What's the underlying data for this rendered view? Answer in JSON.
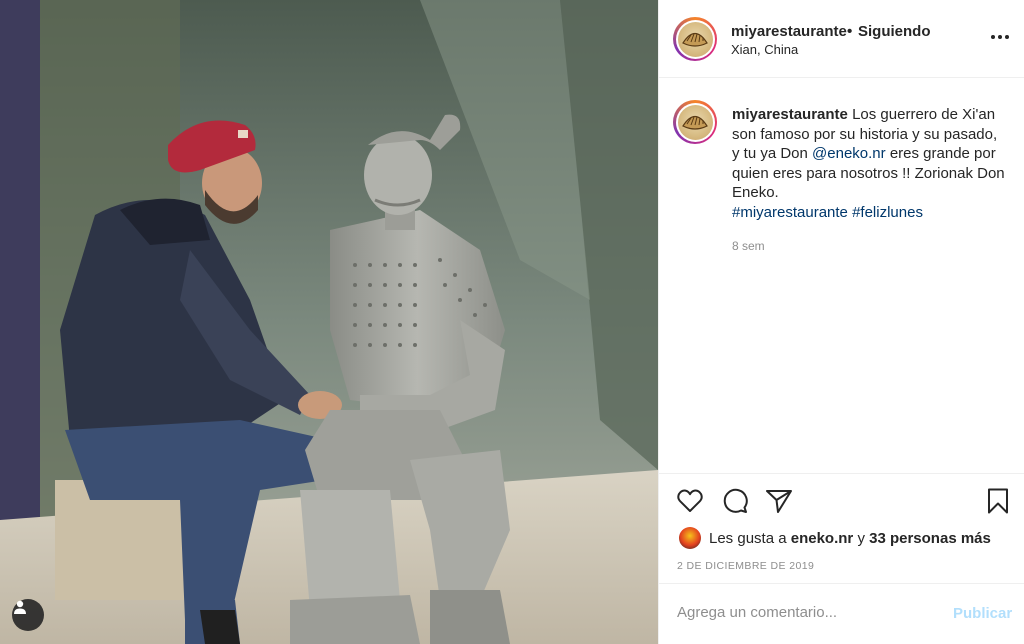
{
  "post": {
    "username": "miyarestaurante",
    "follow_status": "Siguiendo",
    "location": "Xian, China",
    "caption": {
      "username": "miyarestaurante",
      "text_1": "Los guerrero de Xi'an son famoso por su historia y su pasado, y tu ya Don",
      "mention": "@eneko.nr",
      "text_2": "eres grande por quien eres para nosotros !! Zorionak Don Eneko.",
      "hashtag_1": "#miyarestaurante",
      "hashtag_2": "#felizlunes",
      "time": "8 sem"
    },
    "likes": {
      "prefix": "Les gusta a",
      "first_user": "eneko.nr",
      "joiner": "y",
      "others": "33 personas más"
    },
    "date": "2 DE DICIEMBRE DE 2019",
    "comment": {
      "placeholder": "Agrega un comentario...",
      "publish_label": "Publicar"
    }
  },
  "icons": {
    "like": "heart-icon",
    "comment": "comment-icon",
    "share": "paper-plane-icon",
    "save": "bookmark-icon",
    "more": "more-horizontal-icon",
    "user_tag": "user-tag-icon"
  },
  "colors": {
    "link": "#00376b",
    "publish_disabled": "#b2dffc",
    "muted": "#8e8e8e"
  }
}
